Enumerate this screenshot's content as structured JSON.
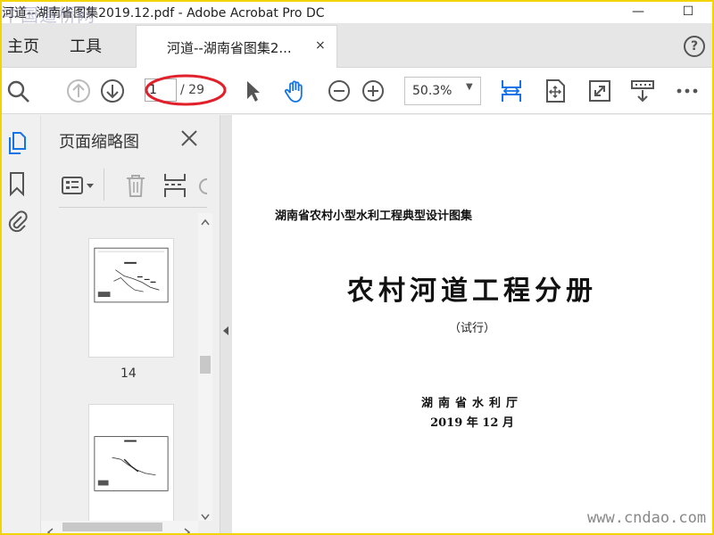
{
  "window": {
    "title": "河道--湖南省图集2019.12.pdf - Adobe Acrobat Pro DC",
    "watermark": "中国道桥网",
    "minimize_glyph": "—",
    "maximize_glyph": "☐"
  },
  "tabs": {
    "home": "主页",
    "tools": "工具",
    "document": "河道--湖南省图集2...",
    "close_glyph": "×",
    "help_glyph": "?"
  },
  "toolbar": {
    "current_page": "1",
    "total_pages": "/ 29",
    "zoom": "50.3%",
    "zoom_caret": "▼",
    "icons": [
      "search-icon",
      "prev-page-icon",
      "next-page-icon",
      "select-cursor-icon",
      "hand-tool-icon",
      "zoom-out-icon",
      "zoom-in-icon",
      "fit-width-icon",
      "fit-page-icon",
      "full-screen-icon",
      "scroll-mode-icon",
      "more-icon"
    ],
    "highlight_color": "#e0202a"
  },
  "rail": {
    "icons": [
      "page-thumbnails-icon",
      "bookmarks-icon",
      "attachments-icon"
    ]
  },
  "panel": {
    "title": "页面缩略图",
    "close_glyph": "✕",
    "thumbnail_label": "14",
    "icons": [
      "thumbnail-options-icon",
      "delete-page-icon",
      "page-layout-icon"
    ]
  },
  "document": {
    "series": "湖南省农村小型水利工程典型设计图集",
    "title": "农村河道工程分册",
    "subtitle": "（试行）",
    "department": "湖南省水利厅",
    "date": "2019 年 12 月"
  },
  "site_watermark": "www.cndao.com",
  "colors": {
    "accent_blue": "#1473e6",
    "frame_yellow": "#f2d400",
    "icon_gray": "#555555"
  }
}
